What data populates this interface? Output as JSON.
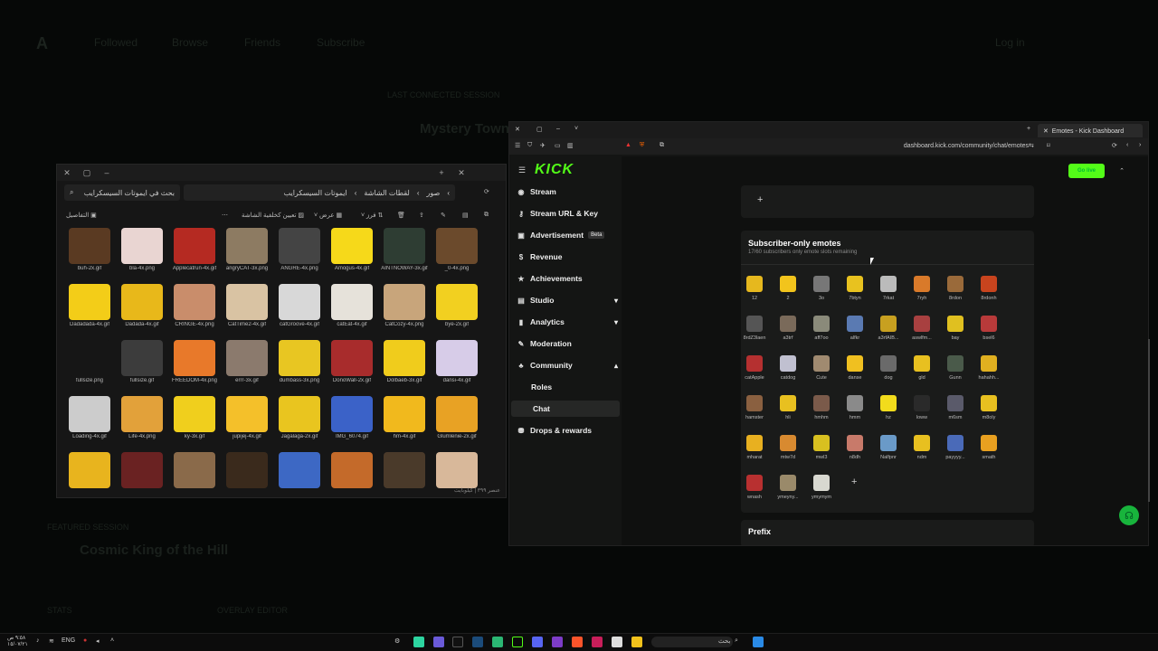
{
  "background": {
    "items": [
      "Followed",
      "Browse",
      "Friends",
      "Subscribe",
      "Log in",
      "LAST CONNECTED SESSION",
      "Mystery Town",
      "FEATURED SESSION",
      "Cosmic King of the Hill",
      "STATS",
      "OVERLAY EDITOR"
    ]
  },
  "explorer": {
    "search_placeholder": "بحث في ايموتات السيسكرايب",
    "breadcrumb": [
      "صور",
      "لقطات الشاشة",
      "ايموتات السيسكرايب"
    ],
    "toolbar": {
      "details": "التفاصيل",
      "set_wallpaper": "تعيين كخلفية الشاشة",
      "view": "عرض",
      "sort": "فرز"
    },
    "files": [
      {
        "name": "buh-2x.gif",
        "color": "#5a3a22"
      },
      {
        "name": "bla-4x.png",
        "color": "#e9d5d2"
      },
      {
        "name": "Applecatrun-4x.gif",
        "color": "#b52a22"
      },
      {
        "name": "angryCAT-3x.png",
        "color": "#8d7b62"
      },
      {
        "name": "ANGRE-4x.png",
        "color": "#444444"
      },
      {
        "name": "Amogus-4x.gif",
        "color": "#f6d91a"
      },
      {
        "name": "AINTNOWAY-3x.gif",
        "color": "#2e3d33"
      },
      {
        "name": "_0-4x.png",
        "color": "#6b4a2c"
      },
      {
        "name": "Dadadada-4x.gif",
        "color": "#f3cd18"
      },
      {
        "name": "Dadada-4x.gif",
        "color": "#e8b81a"
      },
      {
        "name": "CRINGE-4x.png",
        "color": "#c98d6b"
      },
      {
        "name": "CatTime2-4x.gif",
        "color": "#d9c3a3"
      },
      {
        "name": "catGroove-4x.gif",
        "color": "#d8d8d8"
      },
      {
        "name": "catEat-4x.gif",
        "color": "#e6e2da"
      },
      {
        "name": "CatCozy-4x.png",
        "color": "#c8a57b"
      },
      {
        "name": "bye-2x.gif",
        "color": "#f2d020"
      },
      {
        "name": "fullsize.png",
        "color": "#161616"
      },
      {
        "name": "fullsize.gif",
        "color": "#3c3c3c"
      },
      {
        "name": "FREEDOM-4x.png",
        "color": "#e8792a"
      },
      {
        "name": "errr-3x.gif",
        "color": "#8b7a6d"
      },
      {
        "name": "dumbass-3x.png",
        "color": "#e8c622"
      },
      {
        "name": "DonoWall-2x.gif",
        "color": "#a82c2c"
      },
      {
        "name": "Dolbaeb-3x.gif",
        "color": "#f0cc1c"
      },
      {
        "name": "dansi-4x.gif",
        "color": "#d7cce8"
      },
      {
        "name": "Loading-4x.gif",
        "color": "#cccccc"
      },
      {
        "name": "Life-4x.png",
        "color": "#e2a13a"
      },
      {
        "name": "ky-3x.gif",
        "color": "#f0cf1d"
      },
      {
        "name": "jupijej-4x.gif",
        "color": "#f4c02a"
      },
      {
        "name": "Jagalaga-2x.gif",
        "color": "#e9c51f"
      },
      {
        "name": "IMG_6074.gif",
        "color": "#3b62c8"
      },
      {
        "name": "hm-4x.gif",
        "color": "#f1b91d"
      },
      {
        "name": "Glumlenie-2x.gif",
        "color": "#e8a224"
      },
      {
        "name": "",
        "color": "#e8b41e"
      },
      {
        "name": "",
        "color": "#6a2222"
      },
      {
        "name": "",
        "color": "#8a6a4a"
      },
      {
        "name": "",
        "color": "#3a2a1c"
      },
      {
        "name": "",
        "color": "#3d68c4"
      },
      {
        "name": "",
        "color": "#c46a2a"
      },
      {
        "name": "",
        "color": "#4a3a2a"
      },
      {
        "name": "",
        "color": "#d8b89a"
      }
    ],
    "status": "عنصر ٣٩٩ | كيلوبايت"
  },
  "browser": {
    "tab_title": "Emotes - Kick Dashboard",
    "url": "dashboard.kick.com/community/chat/emotes"
  },
  "kick": {
    "logo": "KICK",
    "go_live": "Go live",
    "nav": [
      {
        "label": "Stream",
        "icon": "stream-icon",
        "glyph": "◉"
      },
      {
        "label": "Stream URL & Key",
        "icon": "key-icon",
        "glyph": "⚷"
      },
      {
        "label": "Advertisement",
        "icon": "ad-icon",
        "glyph": "▣",
        "badge": "Beta"
      },
      {
        "label": "Revenue",
        "icon": "revenue-icon",
        "glyph": "$"
      },
      {
        "label": "Achievements",
        "icon": "achievements-icon",
        "glyph": "★"
      },
      {
        "label": "Studio",
        "icon": "studio-icon",
        "glyph": "▤",
        "chevron": "▾"
      },
      {
        "label": "Analytics",
        "icon": "analytics-icon",
        "glyph": "▮",
        "chevron": "▾"
      },
      {
        "label": "Moderation",
        "icon": "moderation-icon",
        "glyph": "✎"
      },
      {
        "label": "Community",
        "icon": "community-icon",
        "glyph": "♣",
        "chevron": "▴"
      }
    ],
    "sub_nav": [
      "Roles",
      "Chat"
    ],
    "nav_last": {
      "label": "Drops & rewards",
      "icon": "drops-icon",
      "glyph": "⛃"
    },
    "subscriber_section": {
      "title": "Subscriber-only emotes",
      "subtitle": "17/60 subscribers only emote slots remaining"
    },
    "prefix_label": "Prefix",
    "emotes": [
      {
        "name": "12",
        "color": "#e6b81e"
      },
      {
        "name": "2",
        "color": "#f2c41c"
      },
      {
        "name": "3o",
        "color": "#777777"
      },
      {
        "name": "7btyn",
        "color": "#e8c21f"
      },
      {
        "name": "7rkat",
        "color": "#bbbbbb"
      },
      {
        "name": "7ryh",
        "color": "#d97a2a"
      },
      {
        "name": "8rdon",
        "color": "#9a6a3a"
      },
      {
        "name": "8rdonh",
        "color": "#c8441e"
      },
      {
        "name": "8rdZ3laen",
        "color": "#555555"
      },
      {
        "name": "a3trf",
        "color": "#7a6a5a"
      },
      {
        "name": "aff7oo",
        "color": "#8a8a7a"
      },
      {
        "name": "alfkr",
        "color": "#5a7ab2"
      },
      {
        "name": "a3rfAIB...",
        "color": "#c8a020"
      },
      {
        "name": "aswlfm...",
        "color": "#a84040"
      },
      {
        "name": "bay",
        "color": "#e0c020"
      },
      {
        "name": "bsel6",
        "color": "#b83a3a"
      },
      {
        "name": "catApple",
        "color": "#b53030"
      },
      {
        "name": "catdog",
        "color": "#c0c0d0"
      },
      {
        "name": "Cute",
        "color": "#a08a70"
      },
      {
        "name": "danse",
        "color": "#f0c020"
      },
      {
        "name": "dog",
        "color": "#6a6a6a"
      },
      {
        "name": "gld",
        "color": "#e8c020"
      },
      {
        "name": "Gunn",
        "color": "#4a5a4a"
      },
      {
        "name": "hahahh...",
        "color": "#e0b020"
      },
      {
        "name": "hamster",
        "color": "#8a6040"
      },
      {
        "name": "hli",
        "color": "#e8c020"
      },
      {
        "name": "hmhm",
        "color": "#7a5a4a"
      },
      {
        "name": "hmm",
        "color": "#8a8a8a"
      },
      {
        "name": "hz",
        "color": "#f2dc1c"
      },
      {
        "name": "loww",
        "color": "#2a2a2a"
      },
      {
        "name": "m6sm",
        "color": "#5a5a6a"
      },
      {
        "name": "m8oly",
        "color": "#e8c020"
      },
      {
        "name": "mharat",
        "color": "#e8b020"
      },
      {
        "name": "mtw7d",
        "color": "#d88a30"
      },
      {
        "name": "mwl3",
        "color": "#d8c020"
      },
      {
        "name": "n8dh",
        "color": "#c87a6a"
      },
      {
        "name": "Nalfpnr",
        "color": "#6a9ac8"
      },
      {
        "name": "ndm",
        "color": "#e8c020"
      },
      {
        "name": "payyyy...",
        "color": "#4a6ab8"
      },
      {
        "name": "smath",
        "color": "#e8a020"
      },
      {
        "name": "wnash",
        "color": "#b83030"
      },
      {
        "name": "ymeyny...",
        "color": "#9a8a6a"
      },
      {
        "name": "ymymym",
        "color": "#d8d8d0"
      }
    ]
  },
  "taskbar": {
    "time": "٩:٥٨ ص",
    "date": "١٥/٠٧/٢١",
    "lang": "ENG",
    "search_label": "بحث"
  }
}
